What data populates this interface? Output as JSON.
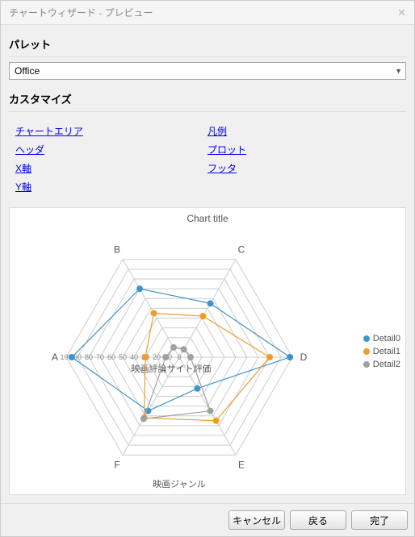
{
  "window": {
    "title": "チャートウィザード - プレビュー"
  },
  "sections": {
    "palette": "パレット",
    "customize": "カスタマイズ"
  },
  "palette": {
    "selected": "Office"
  },
  "links_left": {
    "chart_area": "チャートエリア",
    "header": "ヘッダ",
    "x_axis": "X軸",
    "y_axis": "Y軸"
  },
  "links_right": {
    "legend": "凡例",
    "plot": "プロット",
    "footer": "フッタ"
  },
  "buttons": {
    "cancel": "キャンセル",
    "back": "戻る",
    "finish": "完了"
  },
  "chart_data": {
    "type": "radar",
    "title": "Chart title",
    "categories": [
      "A",
      "B",
      "C",
      "D",
      "E",
      "F"
    ],
    "axis_label_radial": "映画評論サイト評価",
    "axis_label_bottom": "映画ジャンル",
    "ticks": [
      0,
      10,
      20,
      30,
      40,
      50,
      60,
      70,
      80,
      90,
      100
    ],
    "max": 100,
    "series": [
      {
        "name": "Detail0",
        "color": "#3e95cd",
        "values": [
          95,
          70,
          55,
          98,
          32,
          55
        ]
      },
      {
        "name": "Detail1",
        "color": "#f39a2c",
        "values": [
          30,
          45,
          42,
          80,
          65,
          62
        ]
      },
      {
        "name": "Detail2",
        "color": "#a0a0a0",
        "values": [
          12,
          10,
          8,
          10,
          55,
          63
        ]
      }
    ]
  }
}
